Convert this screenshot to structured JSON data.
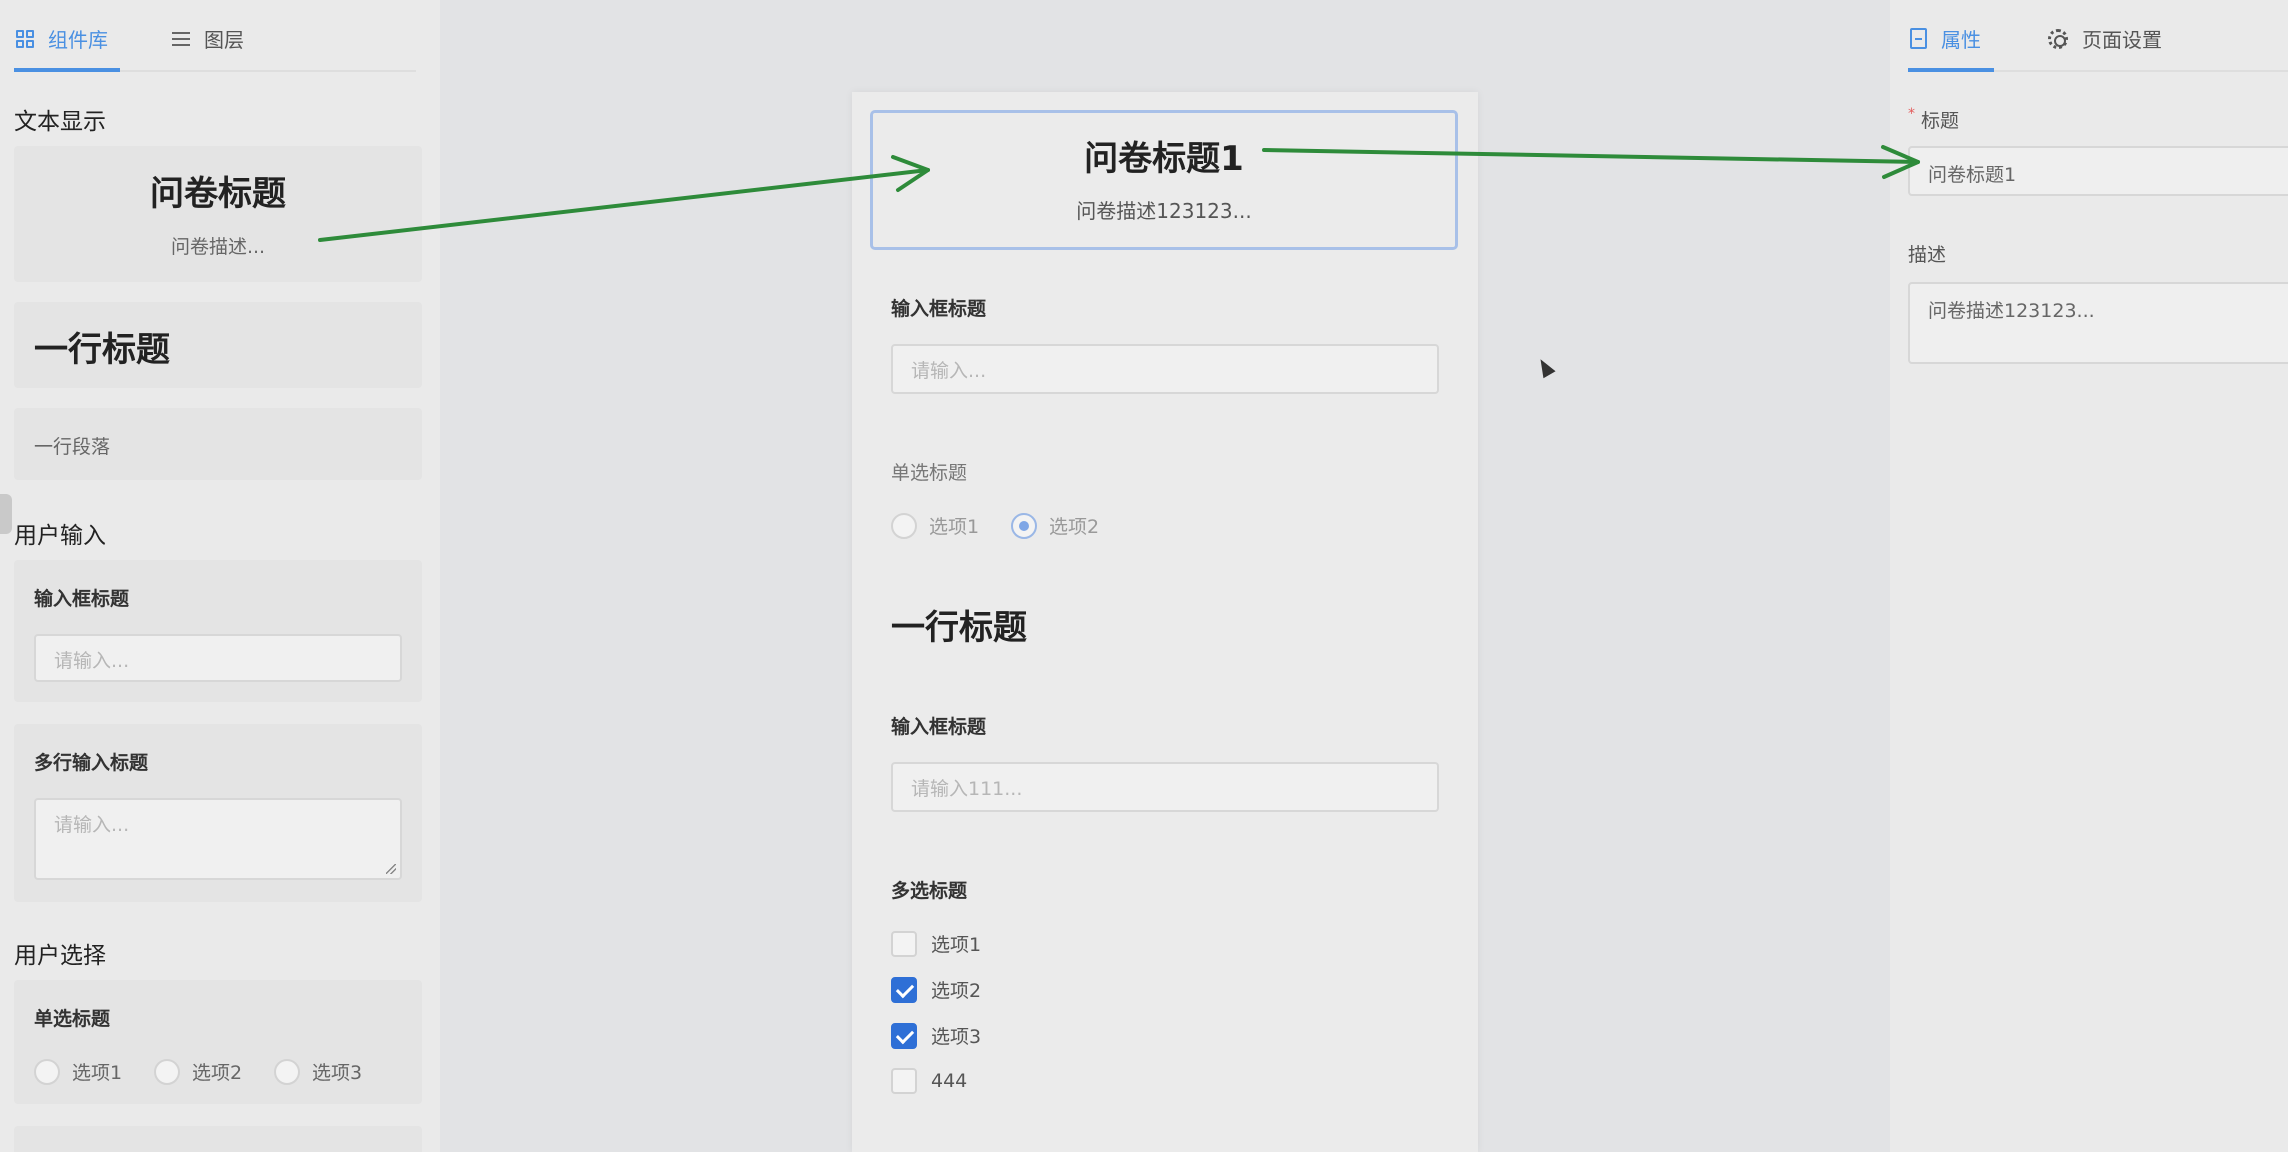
{
  "left_panel": {
    "tabs": [
      {
        "label": "组件库",
        "icon": "component-grid-icon",
        "active": true
      },
      {
        "label": "图层",
        "icon": "layers-list-icon",
        "active": false
      }
    ],
    "sections": {
      "text_display": "文本显示",
      "user_input": "用户输入",
      "user_select": "用户选择"
    },
    "title_component": {
      "title": "问卷标题",
      "desc": "问卷描述..."
    },
    "heading_component": "一行标题",
    "paragraph_component": "一行段落",
    "input_component": {
      "label": "输入框标题",
      "placeholder": "请输入..."
    },
    "textarea_component": {
      "label": "多行输入标题",
      "placeholder": "请输入..."
    },
    "radio_component": {
      "label": "单选标题",
      "options": [
        "选项1",
        "选项2",
        "选项3"
      ]
    }
  },
  "canvas": {
    "header": {
      "title": "问卷标题1",
      "desc": "问卷描述123123..."
    },
    "input1": {
      "label": "输入框标题",
      "placeholder": "请输入..."
    },
    "radio": {
      "label": "单选标题",
      "options": [
        "选项1",
        "选项2"
      ],
      "selected": "选项2"
    },
    "heading": "一行标题",
    "input2": {
      "label": "输入框标题",
      "placeholder": "请输入111..."
    },
    "checkbox": {
      "label": "多选标题",
      "options": [
        {
          "label": "选项1",
          "checked": false
        },
        {
          "label": "选项2",
          "checked": true
        },
        {
          "label": "选项3",
          "checked": true
        },
        {
          "label": "444",
          "checked": false
        }
      ]
    }
  },
  "right_panel": {
    "tabs": [
      {
        "label": "属性",
        "icon": "file-properties-icon",
        "active": true
      },
      {
        "label": "页面设置",
        "icon": "gear-icon",
        "active": false
      }
    ],
    "fields": {
      "title_label": "标题",
      "title_required_mark": "*",
      "title_value": "问卷标题1",
      "desc_label": "描述",
      "desc_value": "问卷描述123123..."
    }
  },
  "colors": {
    "accent": "#4a90e2",
    "arrow": "#2e8b3a",
    "checkbox_checked": "#2e6fd6"
  }
}
